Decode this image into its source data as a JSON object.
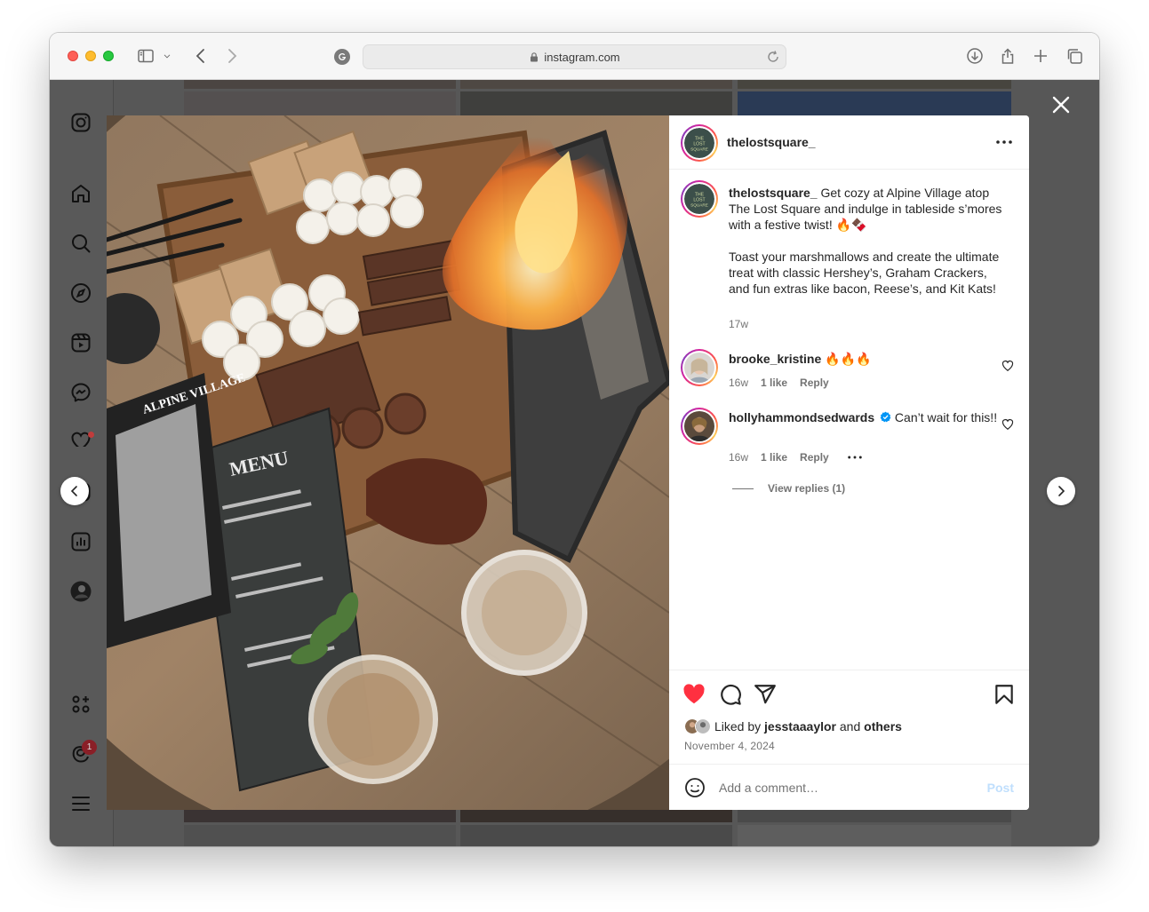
{
  "browser": {
    "url": "instagram.com"
  },
  "post": {
    "author": "thelostsquare_",
    "logo_text": "THE LOST SQUARE",
    "caption_author": "thelostsquare_",
    "caption_line1": " Get cozy at Alpine Village atop The Lost Square and indulge in tableside s’mores with a festive twist! 🔥🍫",
    "caption_line2": "Toast your marshmallows and create the ultimate treat with classic Hershey’s, Graham Crackers, and fun extras like bacon, Reese’s, and Kit Kats!",
    "caption_age": "17w",
    "liked_by_prefix": "Liked by ",
    "liked_by_user": "jesstaaaylor",
    "liked_by_and": " and ",
    "liked_by_others": "others",
    "date": "November 4, 2024",
    "media_text": {
      "menu_title": "MENU",
      "menu_sign": "ALPINE VILLAGE"
    }
  },
  "comments": [
    {
      "user": "brooke_kristine",
      "text": " 🔥🔥🔥",
      "age": "16w",
      "likes": "1 like",
      "reply": "Reply",
      "verified": false
    },
    {
      "user": "hollyhammondsedwards",
      "text": " Can’t wait for this!!",
      "age": "16w",
      "likes": "1 like",
      "reply": "Reply",
      "verified": true,
      "view_replies": "View replies (1)"
    }
  ],
  "comment_box": {
    "placeholder": "Add a comment…",
    "post_label": "Post"
  },
  "sidebar": {
    "notifications_badge": "1",
    "icons": [
      "instagram-icon",
      "home-icon",
      "search-icon",
      "explore-icon",
      "reels-icon",
      "messenger-icon",
      "heart-icon",
      "create-icon",
      "insights-icon",
      "profile-icon",
      "meta-apps-icon",
      "threads-icon",
      "menu-icon"
    ]
  },
  "colors": {
    "like_red": "#ff3040",
    "link_blue": "#0095f6",
    "post_disabled": "#c0dffd"
  }
}
